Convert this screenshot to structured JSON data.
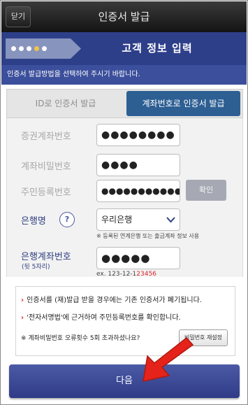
{
  "topbar": {
    "close_label": "닫기",
    "title": "인증서 발급"
  },
  "stepbar": {
    "title": "고객 정보 입력",
    "check": "✓"
  },
  "notice": "인증서 발급방법을 선택하여 주시기 바랍니다.",
  "tabs": {
    "id_issue": "ID로 인증서 발급",
    "account_issue": "계좌번호로 인증서 발급"
  },
  "form": {
    "securities_account": {
      "label": "증권계좌번호",
      "value": "●●●●●●●●"
    },
    "account_password": {
      "label": "계좌비밀번호",
      "value": "●●●●"
    },
    "resident_number": {
      "label": "주민등록번호",
      "value": "●●●●●●●●●●●●●",
      "confirm_label": "확인"
    },
    "bank": {
      "label": "은행명",
      "help": "?",
      "value": "우리은행",
      "note": "※ 등록된 연계은행 또는 출금계좌 정보 사용"
    },
    "bank_account": {
      "label": "은행계좌번호",
      "sublabel": "(뒷 5자리)",
      "value": "●●●●●",
      "example_prefix": "ex. 123-12-1",
      "example_highlight": "23456"
    }
  },
  "info": {
    "line1": "인증서를 (재)발급 받을 경우에는 기존 인증서가 폐기됩니다.",
    "line2": "'전자서명법'에 근거하여 주민등록번호를 확인합니다.",
    "line3": "※ 계좌비밀번호 오류횟수 5회 초과하셨나요?",
    "reset_label": "비밀번호 재설정",
    "bullet": "›"
  },
  "next_label": "다음",
  "colors": {
    "primary": "#2e3f8a",
    "tab_active": "#2d5f93",
    "arrow": "#e5231a"
  }
}
